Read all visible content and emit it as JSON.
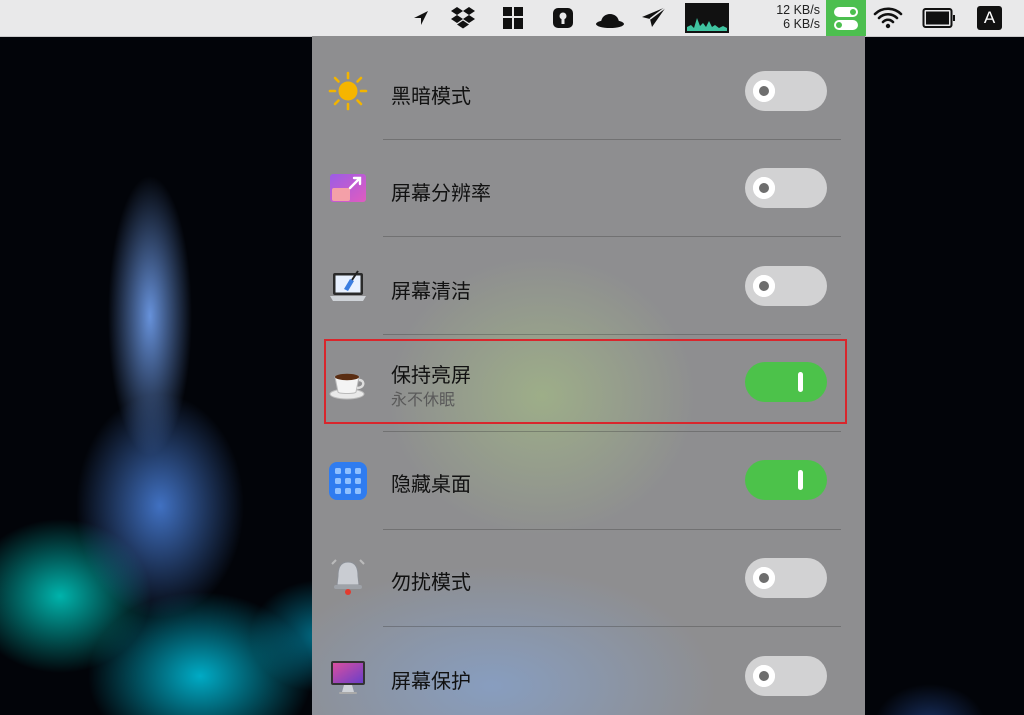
{
  "menubar": {
    "icons": [
      "location-arrow-icon",
      "dropbox-icon",
      "bookmark-app-icon",
      "keyhole-icon",
      "bowler-hat-icon",
      "paper-plane-icon",
      "activity-monitor-icon",
      "toggle-app-icon",
      "wifi-icon",
      "battery-icon",
      "input-source-icon"
    ],
    "network": {
      "upload": "12 KB/s",
      "download": "6 KB/s"
    },
    "input_source": "A",
    "colors": {
      "toggle_app_bg": "#4cbf4f"
    }
  },
  "panel": {
    "items": [
      {
        "icon": "sun-icon",
        "label": "黑暗模式",
        "enabled": false
      },
      {
        "icon": "screen-resolution-icon",
        "label": "屏幕分辨率",
        "enabled": false
      },
      {
        "icon": "laptop-clean-icon",
        "label": "屏幕清洁",
        "enabled": false
      },
      {
        "icon": "coffee-cup-icon",
        "label": "保持亮屏",
        "subtitle": "永不休眠",
        "enabled": true,
        "highlighted": true
      },
      {
        "icon": "app-grid-icon",
        "label": "隐藏桌面",
        "enabled": true
      },
      {
        "icon": "bell-icon",
        "label": "勿扰模式",
        "enabled": false
      },
      {
        "icon": "monitor-icon",
        "label": "屏幕保护",
        "enabled": false
      }
    ],
    "colors": {
      "switch_on": "#4cc24a",
      "switch_off": "#d2d2d3",
      "highlight_border": "#d9262c"
    }
  }
}
